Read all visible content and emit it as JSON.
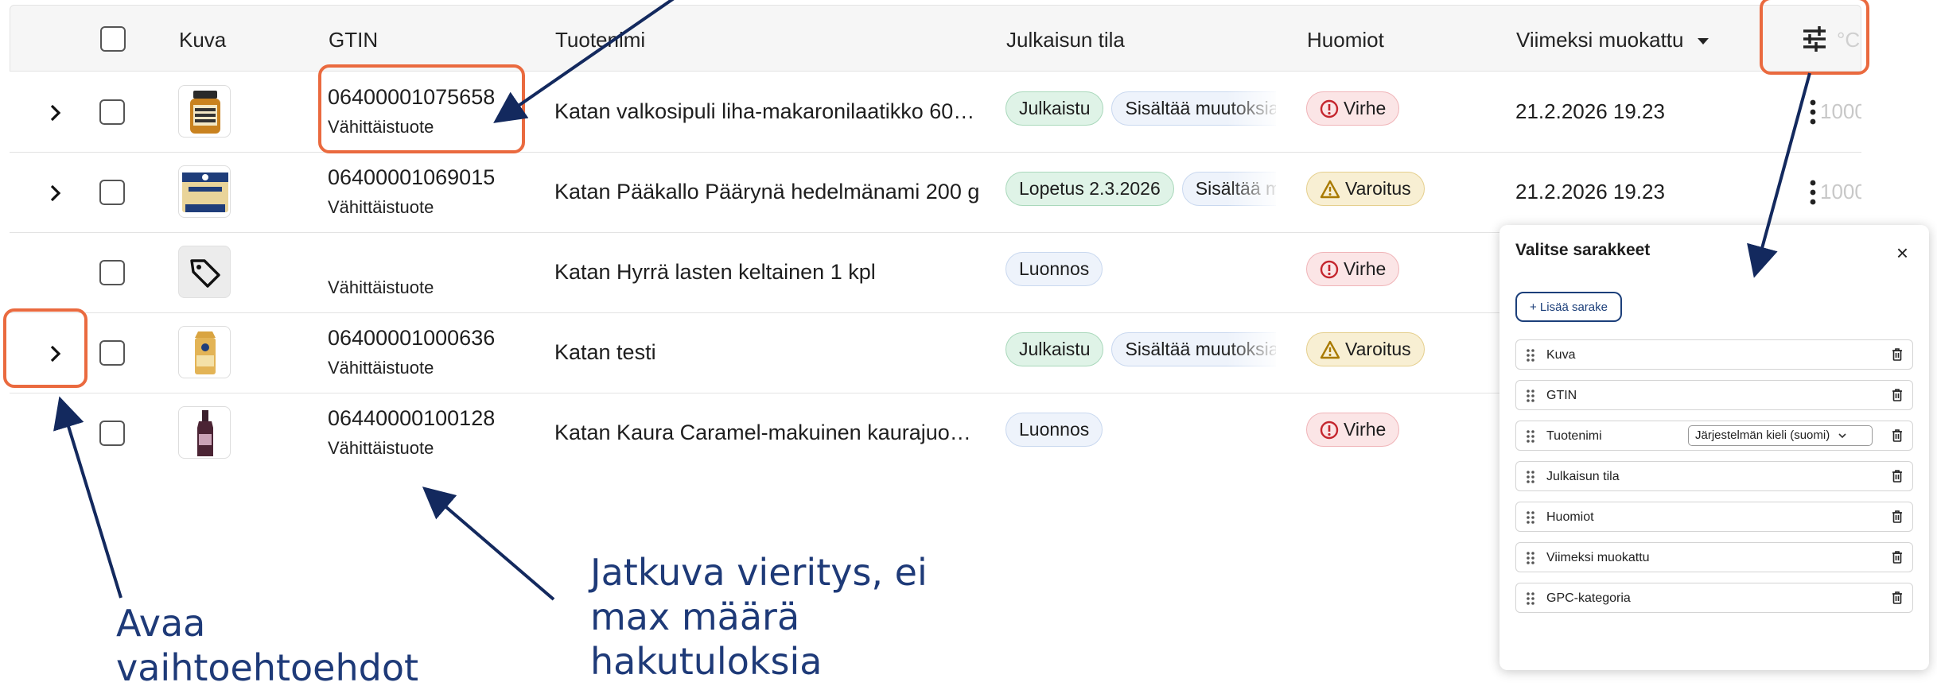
{
  "table": {
    "headers": {
      "image": "Kuva",
      "gtin": "GTIN",
      "product_name": "Tuotenimi",
      "publication_status": "Julkaisun tila",
      "notes": "Huomiot",
      "last_modified": "Viimeksi muokattu",
      "faint_col": "°C"
    },
    "rows": [
      {
        "gtin": "06400001075658",
        "type": "Vähittäistuote",
        "name": "Katan valkosipuli liha-makaronilaatikko 60…",
        "badges": [
          "Julkaistu",
          "Sisältää muutoksia"
        ],
        "note": "Virhe",
        "date": "21.2.2026 19.23",
        "faint": "1000"
      },
      {
        "gtin": "06400001069015",
        "type": "Vähittäistuote",
        "name": "Katan Pääkallo Päärynä hedelmänami 200 g",
        "badges": [
          "Lopetus 2.3.2026",
          "Sisältää muutoksia"
        ],
        "note": "Varoitus",
        "date": "21.2.2026 19.23",
        "faint": "1000"
      },
      {
        "gtin": "",
        "type": "Vähittäistuote",
        "name": "Katan Hyrrä lasten keltainen 1 kpl",
        "badges": [
          "Luonnos"
        ],
        "note": "Virhe",
        "date": "",
        "faint": ""
      },
      {
        "gtin": "06400001000636",
        "type": "Vähittäistuote",
        "name": "Katan testi",
        "badges": [
          "Julkaistu",
          "Sisältää muutoksia"
        ],
        "note": "Varoitus",
        "date": "",
        "faint": ""
      },
      {
        "gtin": "06440000100128",
        "type": "Vähittäistuote",
        "name": "Katan Kaura Caramel-makuinen kaurajuo…",
        "badges": [
          "Luonnos"
        ],
        "note": "Virhe",
        "date": "",
        "faint": ""
      }
    ]
  },
  "panel": {
    "title": "Valitse sarakkeet",
    "close": "×",
    "add_button": "+ Lisää sarake",
    "columns": [
      {
        "label": "Kuva"
      },
      {
        "label": "GTIN"
      },
      {
        "label": "Tuotenimi",
        "select": "Järjestelmän kieli (suomi)"
      },
      {
        "label": "Julkaisun tila"
      },
      {
        "label": "Huomiot"
      },
      {
        "label": "Viimeksi muokattu"
      },
      {
        "label": "GPC-kategoria"
      }
    ]
  },
  "annotations": {
    "left_line1": "Avaa",
    "left_line2": "vaihtoehtoehdot",
    "middle_line1": "Jatkuva vieritys, ei",
    "middle_line2": "max määrä",
    "middle_line3": "hakutuloksia"
  },
  "colors": {
    "highlight": "#ea6a3f",
    "annotation": "#1e3a78"
  }
}
